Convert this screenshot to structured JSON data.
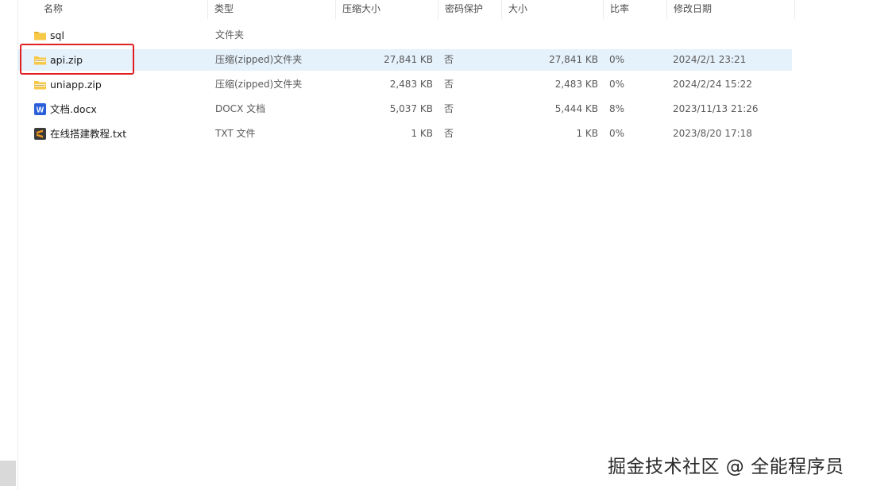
{
  "columns": {
    "name": "名称",
    "type": "类型",
    "packed": "压缩大小",
    "password": "密码保护",
    "size": "大小",
    "ratio": "比率",
    "modified": "修改日期"
  },
  "sort_indicator": "^",
  "files": [
    {
      "name": "sql",
      "icon": "folder-icon",
      "type": "文件夹",
      "packed": "",
      "password": "",
      "size": "",
      "ratio": "",
      "modified": ""
    },
    {
      "name": "api.zip",
      "icon": "zip-folder-icon",
      "type": "压缩(zipped)文件夹",
      "packed": "27,841 KB",
      "password": "否",
      "size": "27,841 KB",
      "ratio": "0%",
      "modified": "2024/2/1 23:21"
    },
    {
      "name": "uniapp.zip",
      "icon": "zip-folder-icon",
      "type": "压缩(zipped)文件夹",
      "packed": "2,483 KB",
      "password": "否",
      "size": "2,483 KB",
      "ratio": "0%",
      "modified": "2024/2/24 15:22"
    },
    {
      "name": "文档.docx",
      "icon": "word-document-icon",
      "type": "DOCX 文档",
      "packed": "5,037 KB",
      "password": "否",
      "size": "5,444 KB",
      "ratio": "8%",
      "modified": "2023/11/13 21:26"
    },
    {
      "name": "在线搭建教程.txt",
      "icon": "sublime-text-file-icon",
      "type": "TXT 文件",
      "packed": "1 KB",
      "password": "否",
      "size": "1 KB",
      "ratio": "0%",
      "modified": "2023/8/20 17:18"
    }
  ],
  "watermark": "掘金技术社区 @ 全能程序员",
  "colors": {
    "selection": "#e5f1fb",
    "highlight_border": "#e02020",
    "folder": "#f8c848",
    "word": "#2b5fd9",
    "sublime": "#f09a1a"
  }
}
